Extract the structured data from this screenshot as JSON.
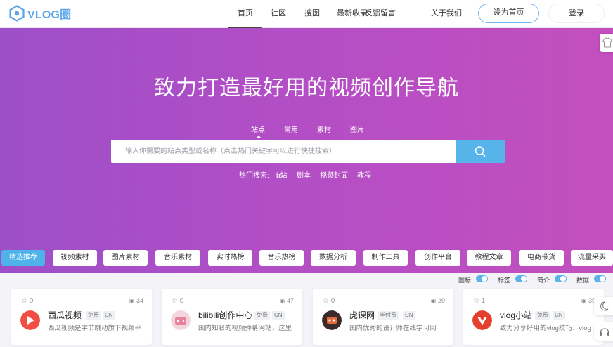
{
  "brand": {
    "name": "VLOG圈"
  },
  "nav": {
    "items": [
      "首页",
      "社区",
      "搜图",
      "最新收录",
      "反馈留言",
      "关于我们"
    ],
    "set_home": "设为首页",
    "login": "登录"
  },
  "hero": {
    "title": "致力打造最好用的视频创作导航",
    "tabs": [
      "站点",
      "常用",
      "素材",
      "图片"
    ],
    "active_tab": "站点",
    "search_placeholder": "输入你需要的站点类型或名称（点击热门关键字可以进行快捷搜索）",
    "hot_label": "热门搜索:",
    "hot_items": [
      "b站",
      "剧本",
      "视频封面",
      "教程"
    ]
  },
  "categories": [
    "精选推荐",
    "视频素材",
    "图片素材",
    "音乐素材",
    "实时热榜",
    "音乐热榜",
    "数据分析",
    "制作工具",
    "创作平台",
    "教程文章",
    "电商带货",
    "流量采买"
  ],
  "toggles": [
    {
      "label": "图标",
      "on": true
    },
    {
      "label": "标签",
      "on": true
    },
    {
      "label": "简介",
      "on": true
    },
    {
      "label": "数据",
      "on": true
    }
  ],
  "cards": [
    {
      "stars": "0",
      "views": "34",
      "name": "西瓜视频",
      "tags": [
        "免费",
        "CN"
      ],
      "desc": "西瓜视频是字节跳动旗下视频平",
      "logo": "xigua-logo"
    },
    {
      "stars": "0",
      "views": "47",
      "name": "bilibili创作中心",
      "tags": [
        "免费",
        "CN"
      ],
      "desc": "国内知名的视频弹幕网站，这里",
      "logo": "bilibili-logo"
    },
    {
      "stars": "0",
      "views": "20",
      "name": "虎课网",
      "tags": [
        "半付费",
        "CN"
      ],
      "desc": "国内优秀的设计师在线学习网",
      "logo": "huke-logo"
    },
    {
      "stars": "1",
      "views": "39",
      "name": "vlog小站",
      "tags": [
        "免费",
        "CN"
      ],
      "desc": "致力分享好用的vlog技巧、vlog",
      "logo": "vlog-logo"
    }
  ],
  "colors": {
    "accent": "#4fb3ea",
    "hero_start": "#9d4fc8",
    "hero_end": "#c34fbd"
  }
}
